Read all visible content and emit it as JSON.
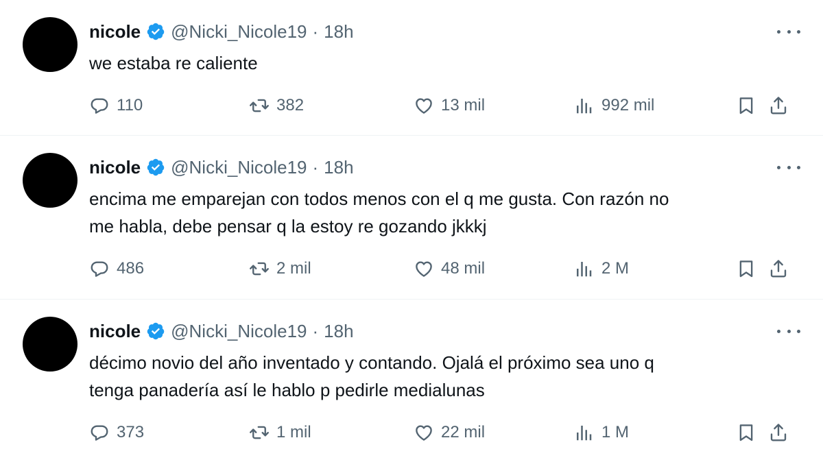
{
  "colors": {
    "verified": "#1d9bf0",
    "text": "#0f1419",
    "muted": "#536471",
    "divider": "#eff3f4"
  },
  "icons": [
    "verified-badge-icon",
    "more-icon",
    "reply-icon",
    "retweet-icon",
    "like-icon",
    "views-icon",
    "bookmark-icon",
    "share-icon"
  ],
  "tweets": [
    {
      "name": "nicole",
      "handle": "@Nicki_Nicole19",
      "separator": "·",
      "time": "18h",
      "text": "we estaba re caliente",
      "replies": "110",
      "retweets": "382",
      "likes": "13 mil",
      "views": "992 mil"
    },
    {
      "name": "nicole",
      "handle": "@Nicki_Nicole19",
      "separator": "·",
      "time": "18h",
      "text": "encima me emparejan con todos menos con el q me gusta. Con razón no\nme habla, debe pensar q la estoy re gozando jkkkj",
      "replies": "486",
      "retweets": "2 mil",
      "likes": "48 mil",
      "views": "2 M"
    },
    {
      "name": "nicole",
      "handle": "@Nicki_Nicole19",
      "separator": "·",
      "time": "18h",
      "text": "décimo novio del año inventado y contando. Ojalá el próximo sea uno q\ntenga panadería así le hablo p pedirle medialunas",
      "replies": "373",
      "retweets": "1 mil",
      "likes": "22 mil",
      "views": "1 M"
    }
  ]
}
